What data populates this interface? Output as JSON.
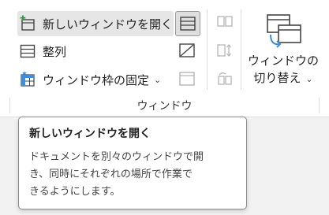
{
  "ribbon": {
    "group_label": "ウィンドウ",
    "open_new": {
      "label": "新しいウィンドウを開く",
      "icon": "new-window-icon"
    },
    "arrange": {
      "label": "整列",
      "icon": "arrange-all-icon"
    },
    "freeze": {
      "label": "ウィンドウ枠の固定",
      "icon": "freeze-panes-icon"
    },
    "switch_window": {
      "line1": "ウィンドウの",
      "line2": "切り替え",
      "icon": "switch-windows-icon"
    },
    "small_buttons": [
      "split-icon",
      "hide-icon",
      "unhide-icon",
      "view-side-by-side-icon",
      "synchronous-scrolling-icon",
      "reset-window-position-icon"
    ],
    "accent": "#3d8fd8"
  },
  "tooltip": {
    "title": "新しいウィンドウを開く",
    "description_line1": "ドキュメントを別々のウィンドウで開",
    "description_line2": "き、同時にそれぞれの場所で作業で",
    "description_line3": "きるようにします。"
  }
}
